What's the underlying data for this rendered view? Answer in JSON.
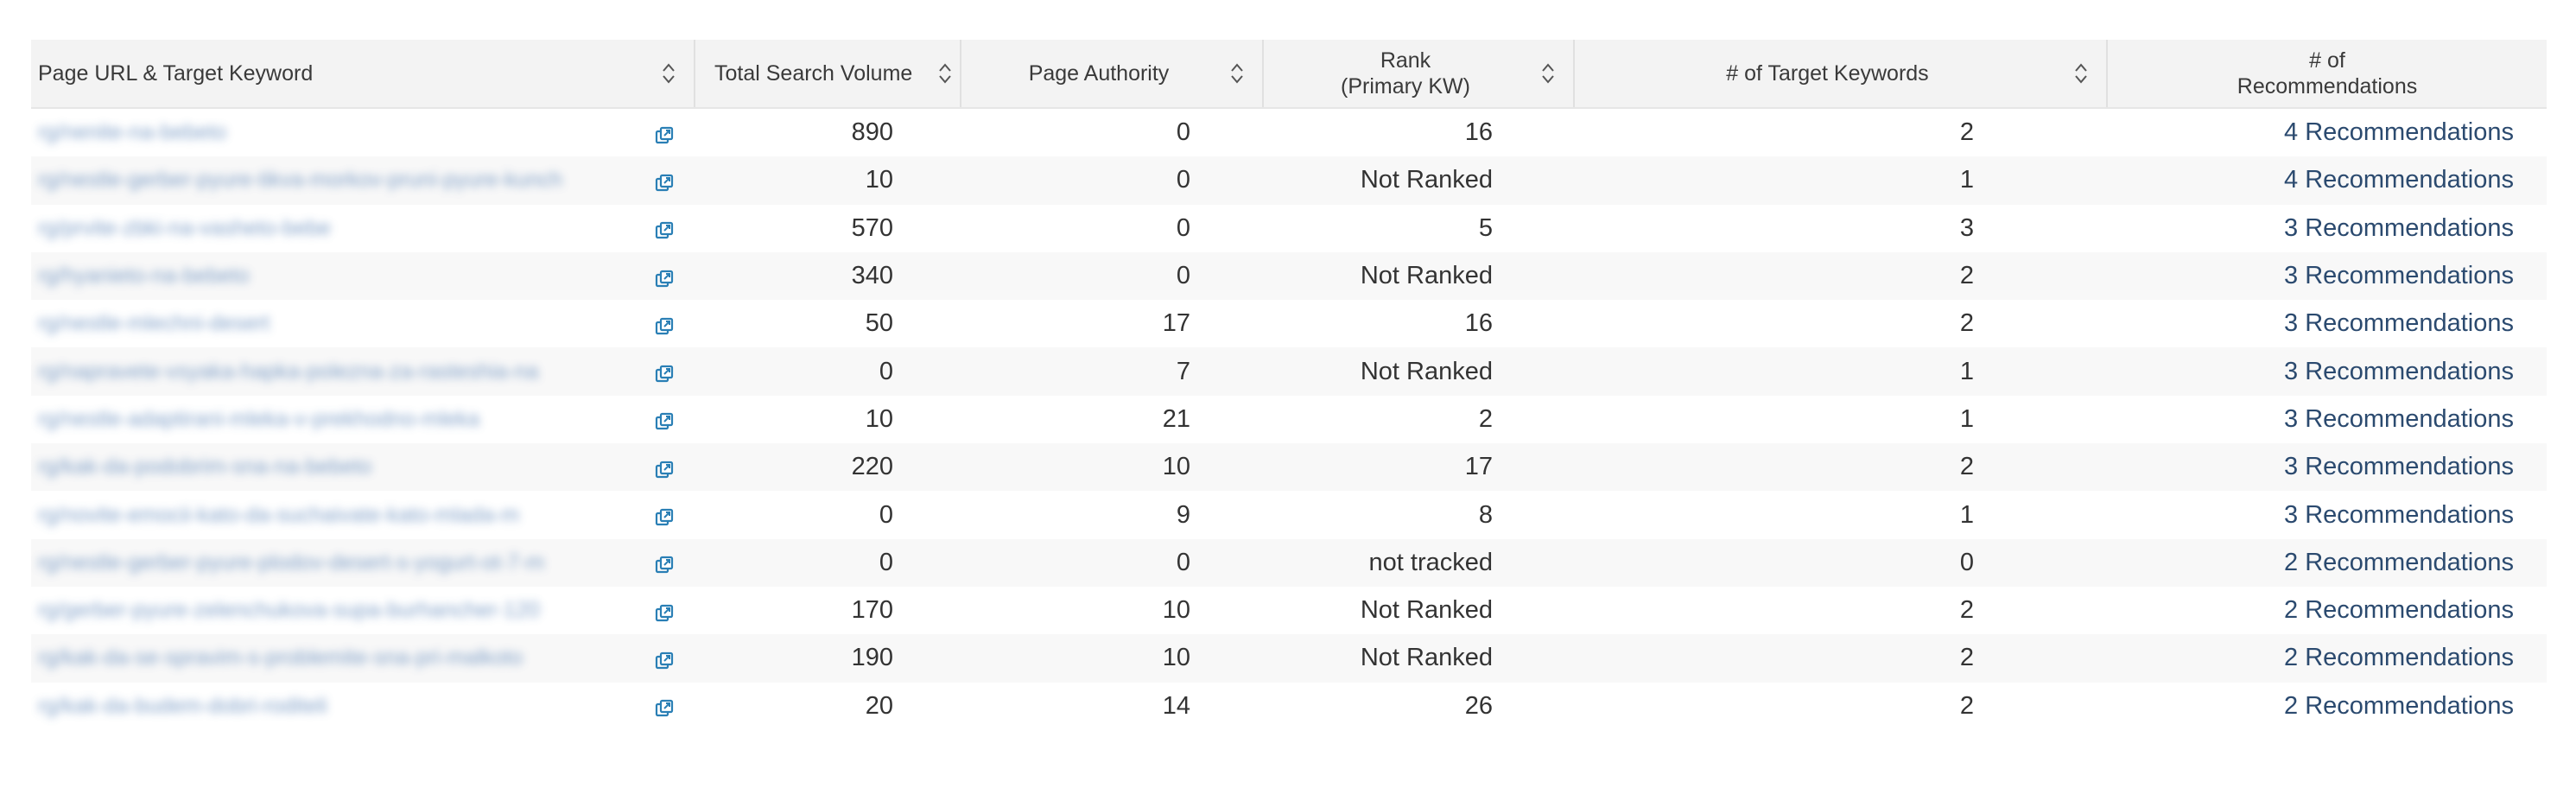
{
  "table": {
    "headers": [
      {
        "label": "Page URL & Target Keyword",
        "sortable": true
      },
      {
        "label": "Total Search Volume",
        "sortable": true
      },
      {
        "label": "Page Authority",
        "sortable": true
      },
      {
        "label": "Rank\n(Primary KW)",
        "line1": "Rank",
        "line2": "(Primary KW)",
        "sortable": true
      },
      {
        "label": "# of Target Keywords",
        "sortable": true
      },
      {
        "label": "# of\nRecommendations",
        "line1": "# of",
        "line2": "Recommendations",
        "sortable": false
      }
    ],
    "rows": [
      {
        "url": "rg/nenite-na-bebeto",
        "volume": "890",
        "authority": "0",
        "rank": "16",
        "keywords": "2",
        "recommendations": "4 Recommendations"
      },
      {
        "url": "rg/nestle-gerber-pyure-tikva-morkov-pruni-pyure-kunch",
        "volume": "10",
        "authority": "0",
        "rank": "Not Ranked",
        "keywords": "1",
        "recommendations": "4 Recommendations"
      },
      {
        "url": "rg/prvite-zbki-na-vasheto-bebe",
        "volume": "570",
        "authority": "0",
        "rank": "5",
        "keywords": "3",
        "recommendations": "3 Recommendations"
      },
      {
        "url": "rg/hyanieto-na-bebeto",
        "volume": "340",
        "authority": "0",
        "rank": "Not Ranked",
        "keywords": "2",
        "recommendations": "3 Recommendations"
      },
      {
        "url": "rg/nestle-mlechni-desert",
        "volume": "50",
        "authority": "17",
        "rank": "16",
        "keywords": "2",
        "recommendations": "3 Recommendations"
      },
      {
        "url": "rg/napravete-vsyaka-hapka-polezna-za-rasteshia-na",
        "volume": "0",
        "authority": "7",
        "rank": "Not Ranked",
        "keywords": "1",
        "recommendations": "3 Recommendations"
      },
      {
        "url": "rg/nestle-adaptirani-mleka-v-prekhodno-mleka",
        "volume": "10",
        "authority": "21",
        "rank": "2",
        "keywords": "1",
        "recommendations": "3 Recommendations"
      },
      {
        "url": "rg/kak-da-podobrim-sna-na-bebeto",
        "volume": "220",
        "authority": "10",
        "rank": "17",
        "keywords": "2",
        "recommendations": "3 Recommendations"
      },
      {
        "url": "rg/novite-emocii-kato-da-suchaivate-kato-mlada-m",
        "volume": "0",
        "authority": "9",
        "rank": "8",
        "keywords": "1",
        "recommendations": "3 Recommendations"
      },
      {
        "url": "rg/nestle-gerber-pyure-plodov-desert-s-yogurt-ot-7-m",
        "volume": "0",
        "authority": "0",
        "rank": "not tracked",
        "keywords": "0",
        "recommendations": "2 Recommendations"
      },
      {
        "url": "rg/gerber-pyure-zelenchukova-supa-burhancher-120",
        "volume": "170",
        "authority": "10",
        "rank": "Not Ranked",
        "keywords": "2",
        "recommendations": "2 Recommendations"
      },
      {
        "url": "rg/kak-da-se-spravim-s-problemite-sna-pri-malkoto",
        "volume": "190",
        "authority": "10",
        "rank": "Not Ranked",
        "keywords": "2",
        "recommendations": "2 Recommendations"
      },
      {
        "url": "rg/kak-da-budem-dobri-roditeli",
        "volume": "20",
        "authority": "14",
        "rank": "26",
        "keywords": "2",
        "recommendations": "2 Recommendations"
      }
    ]
  },
  "colors": {
    "header_bg": "#f3f3f3",
    "row_stripe": "#f8f8f8",
    "link": "#2b4a6f",
    "icon": "#2a7fb5"
  },
  "icons": {
    "sort": "sort-arrows-icon",
    "external": "external-link-icon"
  }
}
